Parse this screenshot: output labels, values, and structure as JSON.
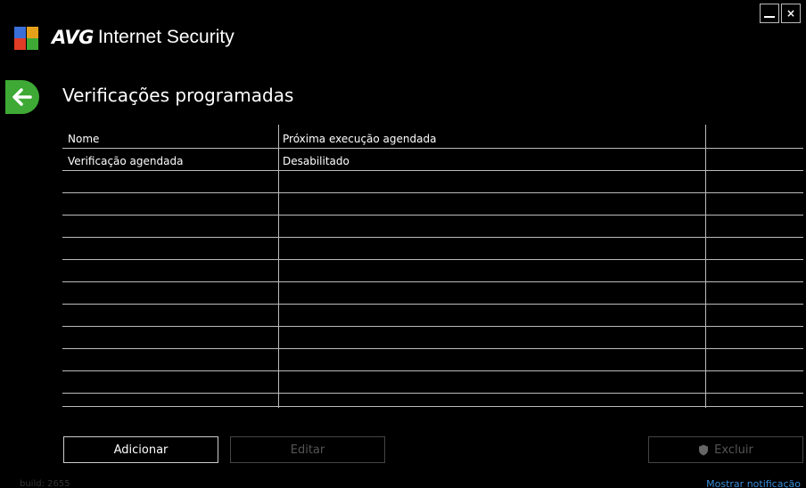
{
  "app": {
    "brand": "AVG",
    "product": "Internet Security",
    "colors": {
      "background": "#000000",
      "accent_green": "#3ea935",
      "link": "#3b8dd8"
    }
  },
  "window_controls": {
    "minimize_icon": "minimize-icon",
    "close_label": "×"
  },
  "page": {
    "title": "Verificações programadas",
    "back_icon": "arrow-left-icon"
  },
  "table": {
    "columns": [
      "Nome",
      "Próxima execução agendada",
      ""
    ],
    "rows": [
      [
        "Verificação agendada",
        "Desabilitado",
        ""
      ]
    ]
  },
  "buttons": {
    "add": "Adicionar",
    "edit": "Editar",
    "delete": "Excluir"
  },
  "footer": {
    "build": "build: 2655",
    "show_notification": "Mostrar notificação"
  }
}
